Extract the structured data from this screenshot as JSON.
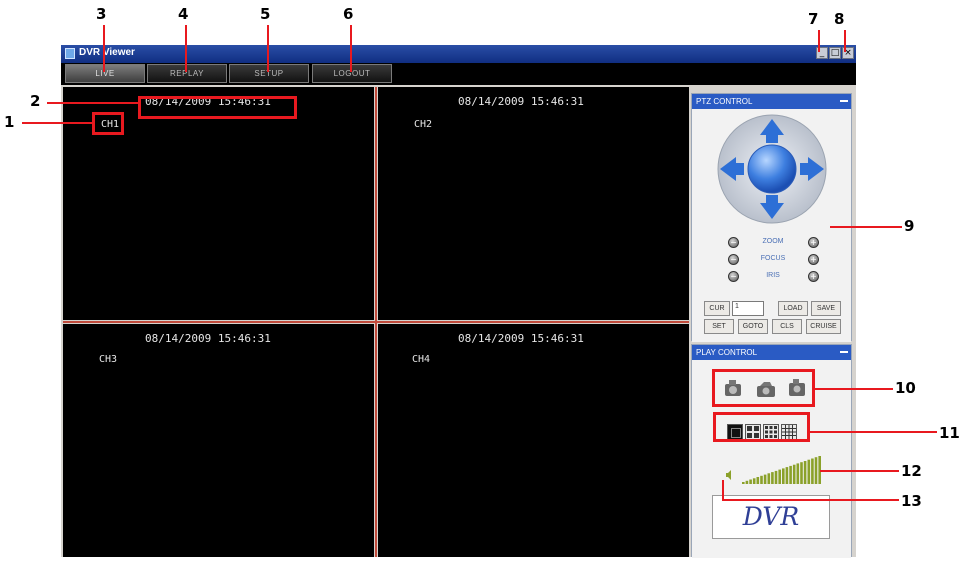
{
  "window": {
    "title": "DVR Viewer"
  },
  "window_controls": {
    "minimize": "_",
    "maximize": "□",
    "close": "×"
  },
  "menu": {
    "tabs": [
      {
        "label": "LIVE"
      },
      {
        "label": "REPLAY"
      },
      {
        "label": "SETUP"
      },
      {
        "label": "LOGOUT"
      }
    ]
  },
  "channels": [
    {
      "name": "CH1",
      "timestamp": "08/14/2009 15:46:31"
    },
    {
      "name": "CH2",
      "timestamp": "08/14/2009 15:46:31"
    },
    {
      "name": "CH3",
      "timestamp": "08/14/2009 15:46:31"
    },
    {
      "name": "CH4",
      "timestamp": "08/14/2009 15:46:31"
    }
  ],
  "ptz": {
    "title": "PTZ CONTROL",
    "zoom_label": "ZOOM",
    "focus_label": "FOCUS",
    "iris_label": "IRIS",
    "minus_symbol": "−",
    "plus_symbol": "+",
    "preset_label": "CUR",
    "preset_value": "1",
    "buttons": {
      "load": "LOAD",
      "save": "SAVE",
      "set": "SET",
      "goto": "GOTO",
      "cls": "CLS",
      "cruise": "CRUISE"
    }
  },
  "play": {
    "title": "PLAY CONTROL",
    "volume_level": 1.0,
    "logo": "DVR"
  },
  "callouts": {
    "n1": "1",
    "n2": "2",
    "n3": "3",
    "n4": "4",
    "n5": "5",
    "n6": "6",
    "n7": "7",
    "n8": "8",
    "n9": "9",
    "n10": "10",
    "n11": "11",
    "n12": "12",
    "n13": "13"
  },
  "colors": {
    "callout_red": "#e8191f",
    "panel_header_blue": "#2a5bc4",
    "channel_divider": "#c04b3c",
    "volume_green": "#8ba12a"
  }
}
